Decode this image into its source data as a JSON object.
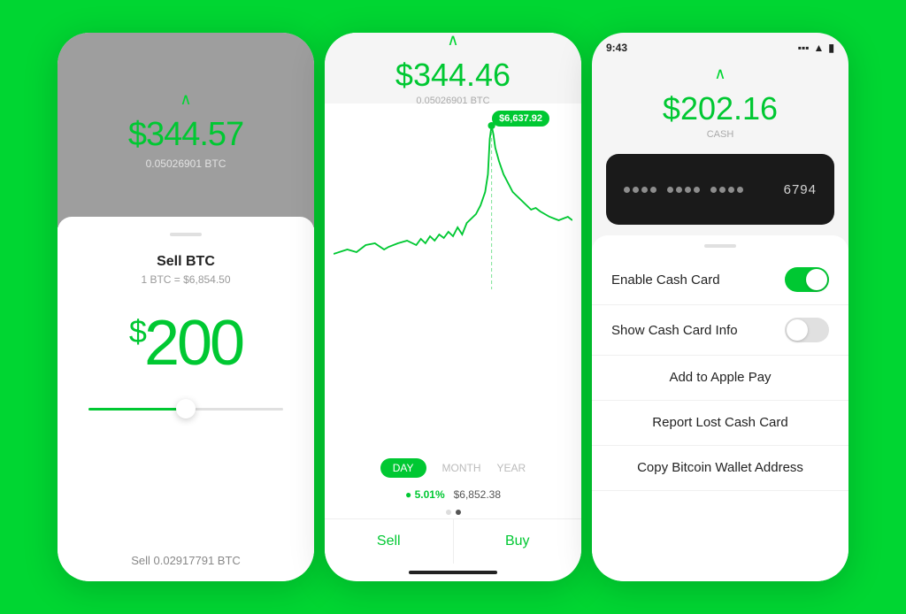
{
  "phone1": {
    "chevron": "∧",
    "amount": "$344.57",
    "btc_sub": "0.05026901 BTC",
    "sell_title": "Sell BTC",
    "sell_rate": "1 BTC = $6,854.50",
    "sell_amount": "200",
    "sell_btc_label": "Sell 0.02917791 BTC"
  },
  "phone2": {
    "chevron": "∧",
    "amount": "$344.46",
    "btc_sub": "0.05026901 BTC",
    "tooltip": "$6,637.92",
    "tabs": [
      "DAY",
      "MONTH",
      "YEAR"
    ],
    "stat_pct": "● 5.01%",
    "stat_val": "$6,852.38",
    "sell_label": "Sell",
    "buy_label": "Buy"
  },
  "phone3": {
    "status_time": "9:43",
    "amount": "$202.16",
    "sub": "CASH",
    "card_last4": "6794",
    "chevron": "∧",
    "enable_cash_card": "Enable Cash Card",
    "show_cash_card_info": "Show Cash Card Info",
    "add_to_apple_pay": "Add to Apple Pay",
    "report_lost": "Report Lost Cash Card",
    "copy_bitcoin": "Copy Bitcoin Wallet Address"
  }
}
